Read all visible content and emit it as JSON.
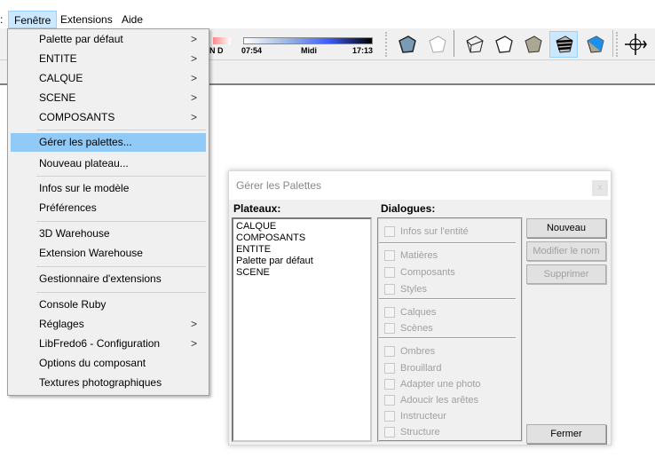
{
  "menubar": {
    "items": [
      {
        "label": "Fenêtre",
        "active": true
      },
      {
        "label": "Extensions"
      },
      {
        "label": "Aide"
      }
    ]
  },
  "toolbar": {
    "shadow": {
      "nd_label": "N  D",
      "time_start": "07:54",
      "time_mid": "Midi",
      "time_end": "17:13"
    },
    "buttons": [
      {
        "icon": "xray-cube-icon"
      },
      {
        "icon": "back-edges-cube-icon"
      },
      {
        "icon": "wireframe-cube-icon"
      },
      {
        "icon": "hidden-line-cube-icon"
      },
      {
        "icon": "shaded-cube-icon"
      },
      {
        "icon": "shaded-textures-cube-icon",
        "selected": true
      },
      {
        "icon": "monochrome-cube-icon"
      },
      {
        "icon": "orbit-compass-icon"
      }
    ]
  },
  "menu": {
    "items": [
      {
        "label": "Palette par défaut",
        "submenu": true
      },
      {
        "label": "ENTITE",
        "submenu": true
      },
      {
        "label": "CALQUE",
        "submenu": true
      },
      {
        "label": "SCENE",
        "submenu": true
      },
      {
        "label": "COMPOSANTS",
        "submenu": true
      },
      {
        "label": "Gérer les palettes...",
        "highlighted": true
      },
      {
        "label": "Nouveau plateau..."
      },
      {
        "label": "Infos sur le modèle"
      },
      {
        "label": "Préférences"
      },
      {
        "label": "3D Warehouse"
      },
      {
        "label": "Extension Warehouse"
      },
      {
        "label": "Gestionnaire d'extensions"
      },
      {
        "label": "Console Ruby"
      },
      {
        "label": "Réglages",
        "submenu": true
      },
      {
        "label": "LibFredo6 - Configuration",
        "submenu": true
      },
      {
        "label": "Options du composant"
      },
      {
        "label": "Textures photographiques"
      }
    ],
    "submenu_glyph": ">"
  },
  "dialog": {
    "title": "Gérer les Palettes",
    "close": "x",
    "plateaux_label": "Plateaux:",
    "plateaux": [
      "CALQUE",
      "COMPOSANTS",
      "ENTITE",
      "Palette par défaut",
      "SCENE"
    ],
    "dialogues_label": "Dialogues:",
    "dialogues": [
      {
        "label": "Infos sur l'entité",
        "checked": false
      },
      {
        "label": "Matières",
        "checked": false
      },
      {
        "label": "Composants",
        "checked": false
      },
      {
        "label": "Styles",
        "checked": false
      },
      {
        "label": "Calques",
        "checked": false
      },
      {
        "label": "Scènes",
        "checked": false
      },
      {
        "label": "Ombres",
        "checked": false
      },
      {
        "label": "Brouillard",
        "checked": false
      },
      {
        "label": "Adapter une photo",
        "checked": false
      },
      {
        "label": "Adoucir les arêtes",
        "checked": false
      },
      {
        "label": "Instructeur",
        "checked": false
      },
      {
        "label": "Structure",
        "checked": false
      }
    ],
    "buttons": {
      "new": "Nouveau",
      "rename": "Modifier le nom",
      "delete": "Supprimer",
      "close": "Fermer"
    }
  }
}
